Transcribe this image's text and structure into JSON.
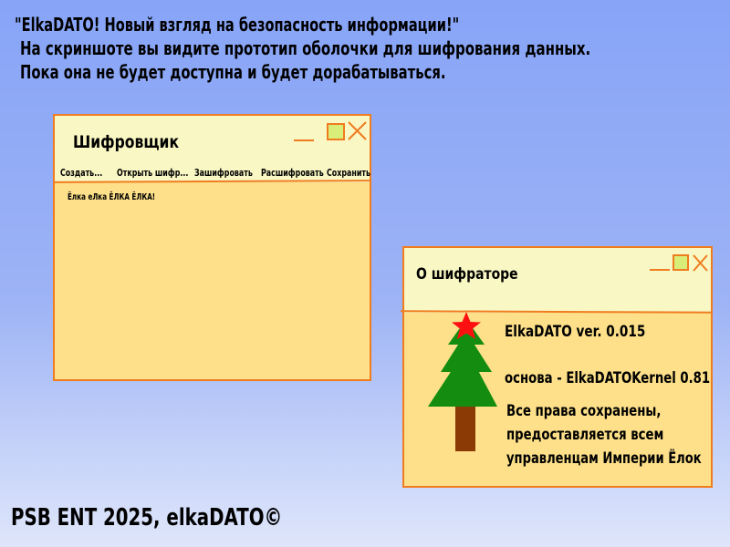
{
  "headline": {
    "line1": "\"ElkaDATO! Новый взгляд на безопасность информации!\"",
    "line2": "На скриншоте вы видите прототип оболочки для шифрования данных.",
    "line3": "Пока она не будет доступна и будет дорабатываться."
  },
  "cipher_window": {
    "title": "Шифровщик",
    "menu": [
      "Создать...",
      "Открыть шифр...",
      "Зашифровать",
      "Расшифровать",
      "Сохранить"
    ],
    "content": "Ёлка еЛка ЁЛКА ЁЛКА!"
  },
  "about_window": {
    "title": "О шифраторе",
    "version": "ElkaDATO ver. 0.015",
    "kernel": "основа - ElkaDATOKernel 0.81",
    "rights_line1": "Все права сохранены,",
    "rights_line2": "предоставляется всем",
    "rights_line3": "управленцам Империи Ёлок",
    "icon": "christmas-tree-icon"
  },
  "footer": "PSB ENT 2025, elkaDATO©",
  "colors": {
    "accent": "#f07c20",
    "window_body": "#fde089",
    "titlebar": "#f9f7c3",
    "maximize_fill": "#d8ee78",
    "tree_green": "#138c10",
    "trunk_brown": "#8b3a06",
    "star_red": "#ff1010"
  }
}
